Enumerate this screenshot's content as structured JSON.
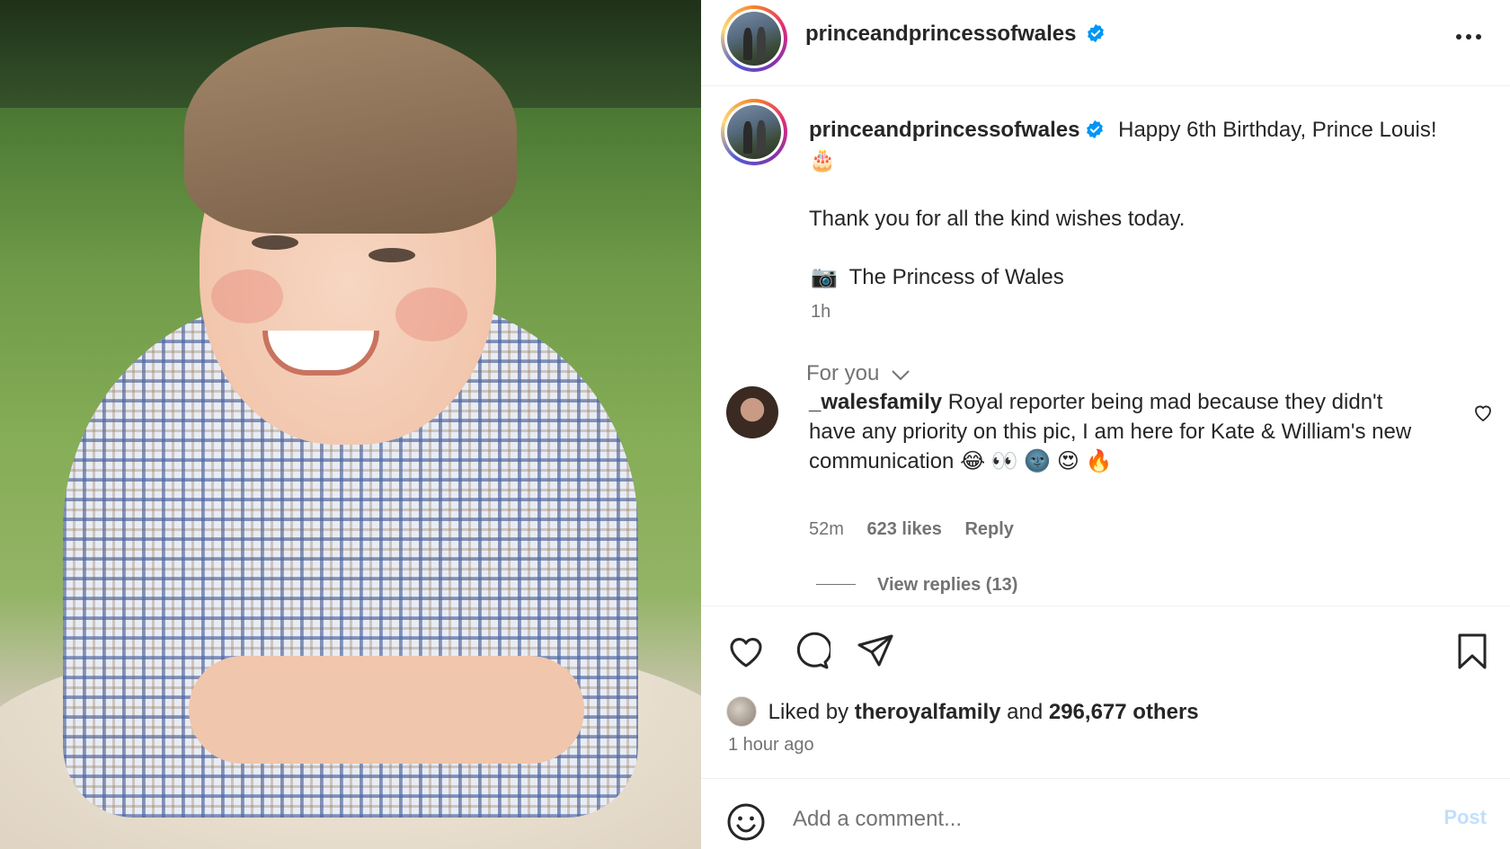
{
  "post": {
    "author": "princeandprincessofwales",
    "verified": true
  },
  "caption": {
    "author": "princeandprincessofwales",
    "text": "Happy 6th Birthday, Prince Louis!",
    "emoji": "🎂",
    "line2": "Thank you for all the kind wishes today.",
    "camera_emoji": "📷",
    "line3": "The Princess of Wales",
    "time": "1h"
  },
  "sort": {
    "label": "For you"
  },
  "comment": {
    "username": "_walesfamily",
    "text": "Royal reporter being mad because they didn't have any priority on this pic, I am here for Kate & William's new communication",
    "emojis": "😂 👀 🌚 😍 🔥",
    "time": "52m",
    "likes": "623 likes",
    "reply_label": "Reply",
    "view_replies": "View replies (13)"
  },
  "engagement": {
    "liked_by_prefix": "Liked by",
    "liked_by_user": "theroyalfamily",
    "and": "and",
    "others": "296,677 others",
    "posted_ago": "1 hour ago"
  },
  "comment_bar": {
    "placeholder": "Add a comment...",
    "post_label": "Post"
  },
  "colors": {
    "verified": "#0095f6",
    "muted_text": "#737373",
    "post_disabled": "#c0dffd"
  },
  "icons": [
    "more-icon",
    "verified-icon",
    "chevron-down-icon",
    "heart-icon",
    "comment-icon",
    "share-icon",
    "bookmark-icon",
    "smiley-icon"
  ]
}
